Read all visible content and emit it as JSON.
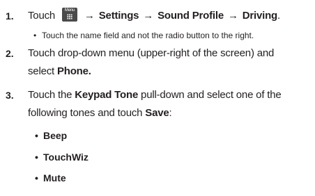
{
  "steps": [
    {
      "number": "1.",
      "lead": "Touch",
      "menu_icon_label": "Menu",
      "path": [
        "Settings",
        "Sound Profile",
        "Driving"
      ],
      "arrow": "→",
      "end": "."
    },
    {
      "number": "2.",
      "line1": "Touch drop-down menu (upper-right of the screen) and",
      "line2_pre": "select ",
      "line2_bold": "Phone."
    },
    {
      "number": "3.",
      "line1_pre": "Touch the ",
      "line1_bold": "Keypad Tone",
      "line1_post": " pull-down and select one of the",
      "line2_pre": "following tones and touch ",
      "line2_bold": "Save",
      "line2_post": ":"
    }
  ],
  "note": "Touch the name field and not the radio button to the right.",
  "bullet_glyph": "•",
  "tones": [
    "Beep",
    "TouchWiz",
    "Mute"
  ]
}
